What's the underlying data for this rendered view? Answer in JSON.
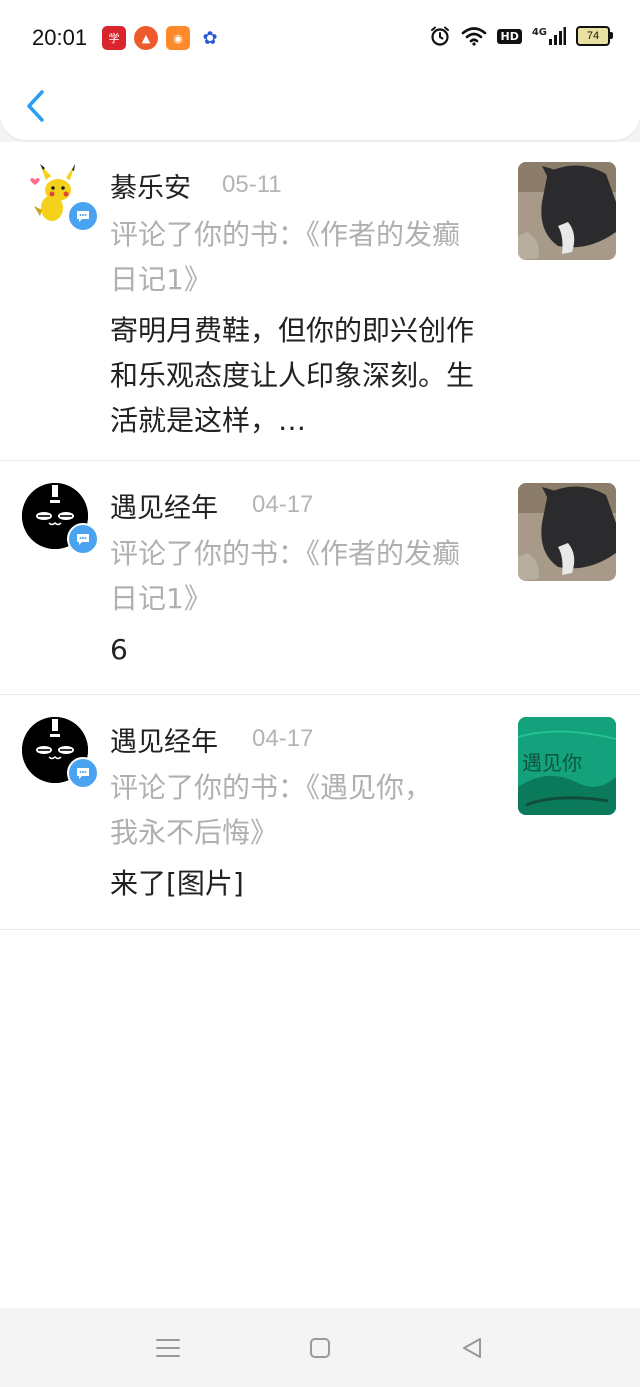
{
  "status_bar": {
    "time": "20:01",
    "app_icons": [
      {
        "name": "news-app-icon",
        "glyph": "学"
      },
      {
        "name": "red-app-icon",
        "glyph": "▲"
      },
      {
        "name": "photo-app-icon",
        "glyph": "◉"
      },
      {
        "name": "baidu-paw-icon",
        "glyph": "✿"
      }
    ],
    "network": "4G",
    "hd": "HD",
    "battery": "74"
  },
  "header": {
    "back_icon": "chevron-left-icon",
    "accent": "#2a9df4"
  },
  "comments": [
    {
      "user": "綦乐安",
      "date": "05-11",
      "action": "评论了你的书：《作者的发癫日记1》",
      "comment": "寄明月费鞋，但你的即兴创作和乐观态度让人印象深刻。生活就是这样，…",
      "avatar": "pikachu-avatar",
      "thumbnail": "cat-photo-thumbnail"
    },
    {
      "user": "遇见经年",
      "date": "04-17",
      "action": "评论了你的书：《作者的发癫日记1》",
      "comment": "6",
      "avatar": "black-cat-avatar",
      "thumbnail": "cat-photo-thumbnail"
    },
    {
      "user": "遇见经年",
      "date": "04-17",
      "action": "评论了你的书：《遇见你，我永不后悔》",
      "comment": "来了[图片]",
      "avatar": "black-cat-avatar",
      "thumbnail": "green-cover-thumbnail",
      "thumbnail_text": "遇见你"
    }
  ],
  "nav_bar": {
    "menu_icon": "menu-icon",
    "home_icon": "home-square-icon",
    "back_icon": "back-triangle-icon"
  }
}
